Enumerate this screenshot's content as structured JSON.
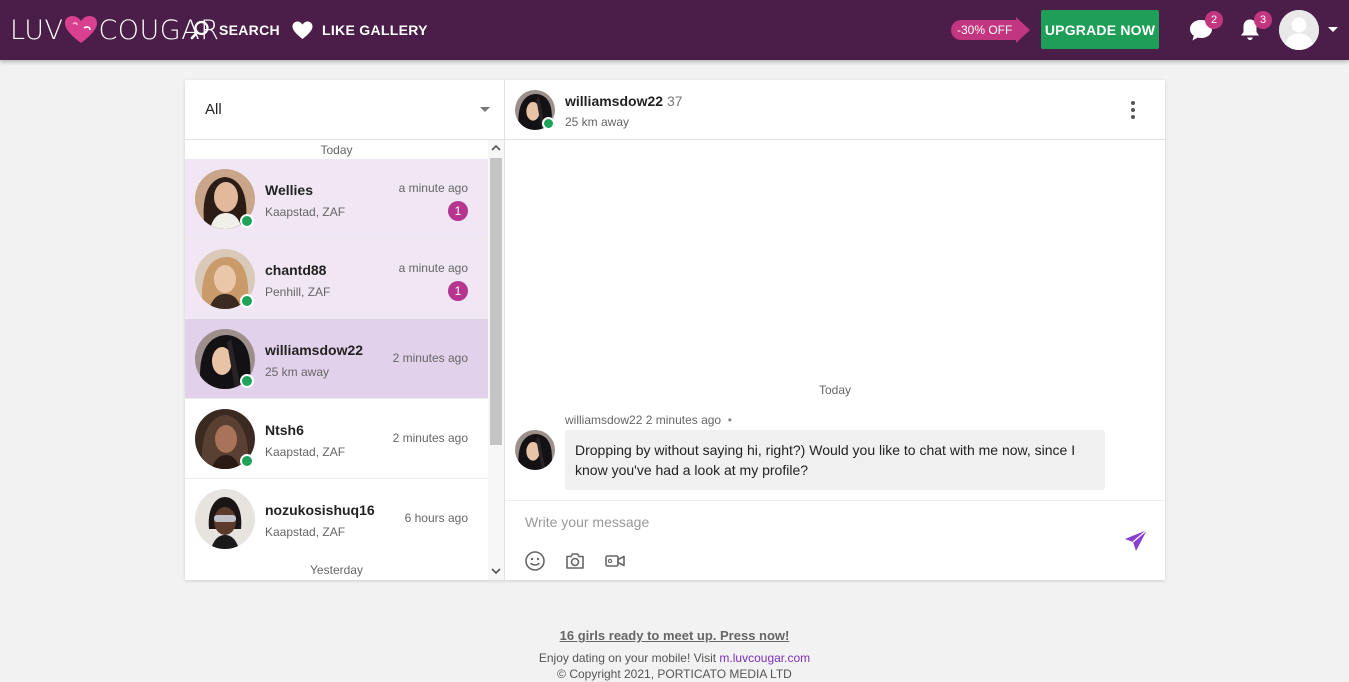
{
  "header": {
    "logo_left": "LUV",
    "logo_right": "COUGAR",
    "search_label": "SEARCH",
    "like_gallery_label": "LIKE GALLERY",
    "promo_badge": "-30% OFF",
    "upgrade_label": "UPGRADE NOW",
    "messages_count": "2",
    "notifications_count": "3",
    "brand_color": "#4a1e48",
    "accent_color": "#c2367f",
    "upgrade_color": "#1e9e57"
  },
  "conversations": {
    "filter_value": "All",
    "day_today": "Today",
    "day_yesterday": "Yesterday",
    "items": [
      {
        "name": "Wellies",
        "location": "Kaapstad, ZAF",
        "time": "a minute ago",
        "unread": "1",
        "online": true,
        "state": "unread"
      },
      {
        "name": "chantd88",
        "location": "Penhill, ZAF",
        "time": "a minute ago",
        "unread": "1",
        "online": true,
        "state": "unread"
      },
      {
        "name": "williamsdow22",
        "location": "25 km away",
        "time": "2 minutes ago",
        "online": true,
        "state": "active"
      },
      {
        "name": "Ntsh6",
        "location": "Kaapstad, ZAF",
        "time": "2 minutes ago",
        "online": true,
        "state": "read"
      },
      {
        "name": "nozukosishuq16",
        "location": "Kaapstad, ZAF",
        "time": "6 hours ago",
        "online": false,
        "state": "read"
      }
    ]
  },
  "chat": {
    "name": "williamsdow22",
    "age": "37",
    "distance": "25 km away",
    "day_label": "Today",
    "message_sender": "williamsdow22",
    "message_time": "2 minutes ago",
    "message_status": "•",
    "message_text": "Dropping by without saying hi, right?) Would you like to chat with me now, since I know you've had a look at my profile?",
    "input_placeholder": "Write your message"
  },
  "footer": {
    "promo_link": "16 girls ready to meet up. Press now!",
    "mobile_text": "Enjoy dating on your mobile! Visit",
    "mobile_link": "m.luvcougar.com",
    "copyright": "© Copyright 2021, PORTICATO MEDIA LTD"
  }
}
